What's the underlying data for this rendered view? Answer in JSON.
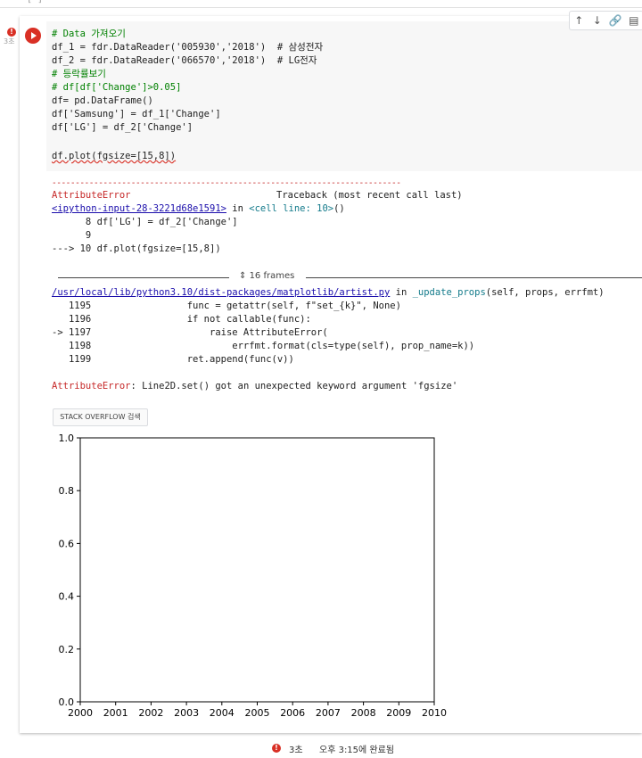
{
  "top": {
    "dots": "[ ]"
  },
  "cell": {
    "status_icon": "!",
    "exec_time": "3초",
    "toolbar": {
      "up": "↑",
      "down": "↓",
      "link": "🔗",
      "comment": "▤"
    },
    "code": [
      "# Data 가져오기",
      "df_1 = fdr.DataReader('005930','2018')  # 삼성전자",
      "df_2 = fdr.DataReader('066570','2018')  # LG전자",
      "# 등락률보기",
      "# df[df['Change']>0.05]",
      "df= pd.DataFrame()",
      "df['Samsung'] = df_1['Change']",
      "df['LG'] = df_2['Change']",
      "",
      "df.plot(fgsize=[15,8])"
    ]
  },
  "output": {
    "separator": "---------------------------------------------------------------------------",
    "error_name": "AttributeError",
    "traceback_label": "Traceback (most recent call last)",
    "input_link": "<ipython-input-28-3221d68e1591>",
    "in_word": " in ",
    "cell_ref": "<cell line: 10>",
    "cell_ref_paren": "()",
    "tb_lines": [
      "      8 df['LG'] = df_2['Change']",
      "      9 ",
      "---> 10 df.plot(fgsize=[15,8])"
    ],
    "frames_label": "16 frames",
    "artist_link": "/usr/local/lib/python3.10/dist-packages/matplotlib/artist.py",
    "artist_func": "_update_props",
    "artist_args": "(self, props, errfmt)",
    "src_lines": [
      "   1195                 func = getattr(self, f\"set_{k}\", None)",
      "   1196                 if not callable(func):",
      "-> 1197                     raise AttributeError(",
      "   1198                         errfmt.format(cls=type(self), prop_name=k))",
      "   1199                 ret.append(func(v))"
    ],
    "final_error_name": "AttributeError",
    "final_error_msg": ": Line2D.set() got an unexpected keyword argument 'fgsize'",
    "so_button": "STACK OVERFLOW 검색"
  },
  "chart_data": {
    "type": "line",
    "x_ticks": [
      "2000",
      "2001",
      "2002",
      "2003",
      "2004",
      "2005",
      "2006",
      "2007",
      "2008",
      "2009",
      "2010"
    ],
    "y_ticks": [
      "0.0",
      "0.2",
      "0.4",
      "0.6",
      "0.8",
      "1.0"
    ],
    "xlim": [
      2000,
      2010
    ],
    "ylim": [
      0,
      1
    ],
    "series": [],
    "grid": false
  },
  "statusbar": {
    "icon": "!",
    "duration": "3초",
    "completed": "오후 3:15에 완료됨"
  }
}
